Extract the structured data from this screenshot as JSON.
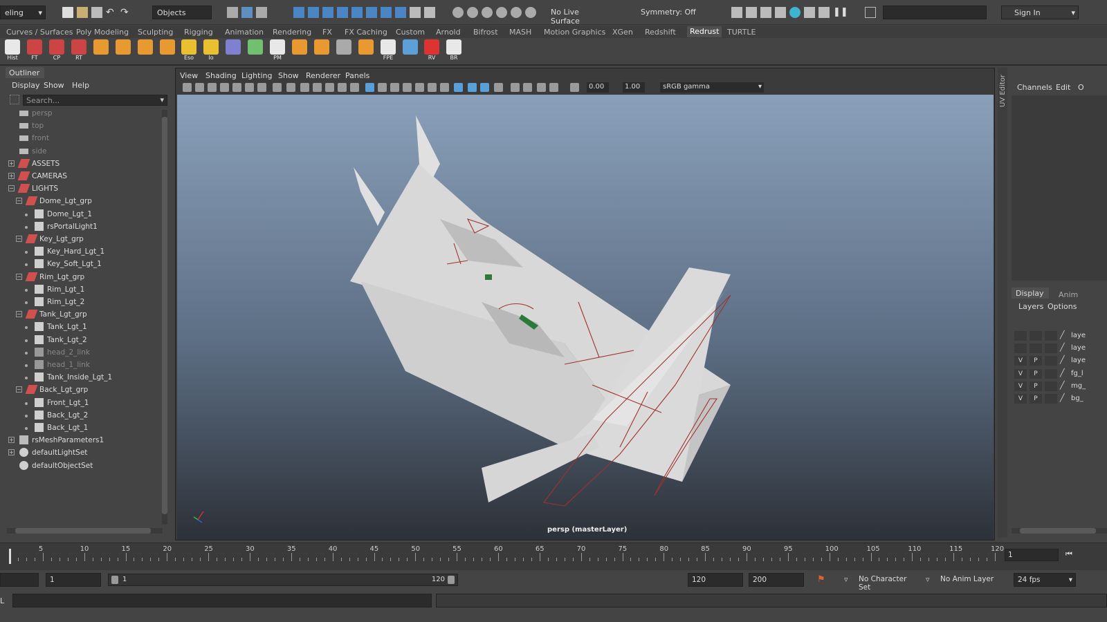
{
  "topbar": {
    "mode": "eling",
    "selection_mode": "Objects",
    "live_surface": "No Live Surface",
    "symmetry": "Symmetry: Off",
    "sign_in": "Sign In"
  },
  "shelf_tabs": [
    "Curves / Surfaces",
    "Poly Modeling",
    "Sculpting",
    "Rigging",
    "Animation",
    "Rendering",
    "FX",
    "FX Caching",
    "Custom",
    "Arnold",
    "Bifrost",
    "MASH",
    "Motion Graphics",
    "XGen",
    "Redshift",
    "Redrust",
    "TURTLE"
  ],
  "shelf_tab_active": "Redrust",
  "shelf_icons": [
    {
      "label": "Hist",
      "color": "#e8e8e8"
    },
    {
      "label": "FT",
      "color": "#cc4444"
    },
    {
      "label": "CP",
      "color": "#cc4444"
    },
    {
      "label": "RT",
      "color": "#cc4444"
    },
    {
      "label": "",
      "color": "#e89a30"
    },
    {
      "label": "",
      "color": "#e89a30"
    },
    {
      "label": "",
      "color": "#e89a30"
    },
    {
      "label": "",
      "color": "#e89a30"
    },
    {
      "label": "Eso",
      "color": "#e8c030"
    },
    {
      "label": "Io",
      "color": "#e8c030"
    },
    {
      "label": "",
      "color": "#8080d0"
    },
    {
      "label": "",
      "color": "#70c070"
    },
    {
      "label": "PM",
      "color": "#e8e8e8"
    },
    {
      "label": "",
      "color": "#e89a30"
    },
    {
      "label": "",
      "color": "#e89a30"
    },
    {
      "label": "",
      "color": "#aaaaaa"
    },
    {
      "label": "",
      "color": "#e89a30"
    },
    {
      "label": "FPE",
      "color": "#e8e8e8"
    },
    {
      "label": "",
      "color": "#5da0d8"
    },
    {
      "label": "RV",
      "color": "#dd3333"
    },
    {
      "label": "BR",
      "color": "#e8e8e8"
    }
  ],
  "outliner": {
    "title": "Outliner",
    "menus": [
      "Display",
      "Show",
      "Help"
    ],
    "search_placeholder": "Search...",
    "items": [
      {
        "label": "persp",
        "indent": 0,
        "expander": "",
        "icon": "camera-icon",
        "dim": true
      },
      {
        "label": "top",
        "indent": 0,
        "expander": "",
        "icon": "camera-icon",
        "dim": true
      },
      {
        "label": "front",
        "indent": 0,
        "expander": "",
        "icon": "camera-icon",
        "dim": true
      },
      {
        "label": "side",
        "indent": 0,
        "expander": "",
        "icon": "camera-icon",
        "dim": true
      },
      {
        "label": "ASSETS",
        "indent": 0,
        "expander": "+",
        "icon": "group-icon",
        "dim": false
      },
      {
        "label": "CAMERAS",
        "indent": 0,
        "expander": "+",
        "icon": "group-icon",
        "dim": false
      },
      {
        "label": "LIGHTS",
        "indent": 0,
        "expander": "-",
        "icon": "group-icon",
        "dim": false
      },
      {
        "label": "Dome_Lgt_grp",
        "indent": 1,
        "expander": "-",
        "icon": "group-icon",
        "dim": false
      },
      {
        "label": "Dome_Lgt_1",
        "indent": 2,
        "expander": "",
        "icon": "light-icon",
        "dim": false
      },
      {
        "label": "rsPortalLight1",
        "indent": 2,
        "expander": "",
        "icon": "light-icon",
        "dim": false
      },
      {
        "label": "Key_Lgt_grp",
        "indent": 1,
        "expander": "-",
        "icon": "group-icon",
        "dim": false
      },
      {
        "label": "Key_Hard_Lgt_1",
        "indent": 2,
        "expander": "",
        "icon": "light-icon",
        "dim": false
      },
      {
        "label": "Key_Soft_Lgt_1",
        "indent": 2,
        "expander": "",
        "icon": "light-icon",
        "dim": false
      },
      {
        "label": "Rim_Lgt_grp",
        "indent": 1,
        "expander": "-",
        "icon": "group-icon",
        "dim": false
      },
      {
        "label": "Rim_Lgt_1",
        "indent": 2,
        "expander": "",
        "icon": "light-icon",
        "dim": false
      },
      {
        "label": "Rim_Lgt_2",
        "indent": 2,
        "expander": "",
        "icon": "light-icon",
        "dim": false
      },
      {
        "label": "Tank_Lgt_grp",
        "indent": 1,
        "expander": "-",
        "icon": "group-icon",
        "dim": false
      },
      {
        "label": "Tank_Lgt_1",
        "indent": 2,
        "expander": "",
        "icon": "light-icon",
        "dim": false
      },
      {
        "label": "Tank_Lgt_2",
        "indent": 2,
        "expander": "",
        "icon": "light-icon",
        "dim": false
      },
      {
        "label": "head_2_link",
        "indent": 2,
        "expander": "",
        "icon": "link-icon",
        "dim": true
      },
      {
        "label": "head_1_link",
        "indent": 2,
        "expander": "",
        "icon": "link-icon",
        "dim": true
      },
      {
        "label": "Tank_Inside_Lgt_1",
        "indent": 2,
        "expander": "",
        "icon": "light-icon",
        "dim": false
      },
      {
        "label": "Back_Lgt_grp",
        "indent": 1,
        "expander": "-",
        "icon": "group-icon",
        "dim": false
      },
      {
        "label": "Front_Lgt_1",
        "indent": 2,
        "expander": "",
        "icon": "light-icon",
        "dim": false
      },
      {
        "label": "Back_Lgt_2",
        "indent": 2,
        "expander": "",
        "icon": "light-icon",
        "dim": false
      },
      {
        "label": "Back_Lgt_1",
        "indent": 2,
        "expander": "",
        "icon": "light-icon",
        "dim": false
      },
      {
        "label": "rsMeshParameters1",
        "indent": 0,
        "expander": "+",
        "icon": "mesh-params-icon",
        "dim": false
      },
      {
        "label": "defaultLightSet",
        "indent": 0,
        "expander": "+",
        "icon": "set-icon",
        "dim": false
      },
      {
        "label": "defaultObjectSet",
        "indent": 0,
        "expander": "",
        "icon": "set-icon",
        "dim": false
      }
    ]
  },
  "viewport": {
    "menus": [
      "View",
      "Shading",
      "Lighting",
      "Show",
      "Renderer",
      "Panels"
    ],
    "exposure": "0.00",
    "gamma": "1.00",
    "color_space": "sRGB gamma",
    "camera_label": "persp (masterLayer)"
  },
  "right_panel": {
    "side_tab": "UV Editor",
    "channel_menus": [
      "Channels",
      "Edit",
      "O"
    ],
    "tabs": [
      "Display",
      "Anim"
    ],
    "active_tab": "Display",
    "sub_menus": [
      "Layers",
      "Options"
    ],
    "layers": [
      {
        "v": "",
        "p": "",
        "name": "laye"
      },
      {
        "v": "",
        "p": "",
        "name": "laye"
      },
      {
        "v": "V",
        "p": "P",
        "name": "laye"
      },
      {
        "v": "V",
        "p": "P",
        "name": "fg_l"
      },
      {
        "v": "V",
        "p": "P",
        "name": "mg_"
      },
      {
        "v": "V",
        "p": "P",
        "name": "bg_"
      }
    ]
  },
  "timeline": {
    "ticks": [
      "5",
      "10",
      "15",
      "20",
      "25",
      "30",
      "35",
      "40",
      "45",
      "50",
      "55",
      "60",
      "65",
      "70",
      "75",
      "80",
      "85",
      "90",
      "95",
      "100",
      "105",
      "110",
      "115",
      "120"
    ],
    "current_frame": "1"
  },
  "range": {
    "start": "1",
    "range_start": "1",
    "range_end": "120",
    "end": "120",
    "max": "200",
    "character_set": "No Character Set",
    "anim_layer": "No Anim Layer",
    "fps": "24 fps"
  },
  "command_line": {
    "lang": "L"
  }
}
